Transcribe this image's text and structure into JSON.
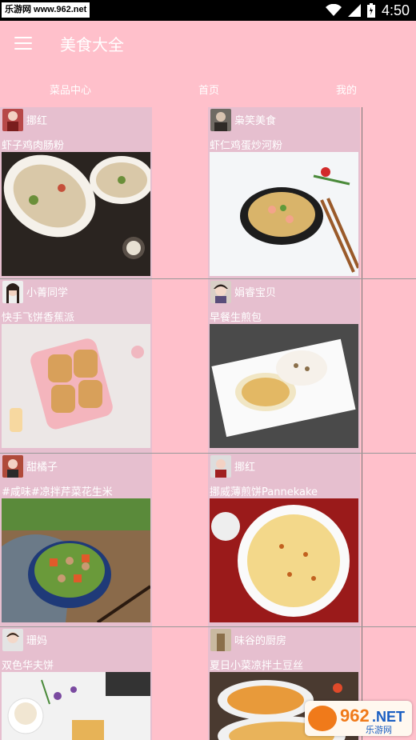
{
  "status_bar": {
    "watermark": "乐游网 www.962.net",
    "time": "4:50"
  },
  "app_bar": {
    "title": "美食大全",
    "menu_icon": "hamburger-menu-icon"
  },
  "tabs": [
    {
      "label": "菜品中心"
    },
    {
      "label": "首页"
    },
    {
      "label": "我的"
    }
  ],
  "cards": [
    {
      "author": "挪红",
      "dish": "虾子鸡肉肠粉",
      "photo": "rice-noodle-rolls-in-white-dishes"
    },
    {
      "author": "枭笑美食",
      "dish": "虾仁鸡蛋炒河粉",
      "photo": "fried-noodles-in-black-pan"
    },
    {
      "author": "小菁同学",
      "dish": "快手飞饼香蕉派",
      "photo": "banana-pies-on-pink-plate"
    },
    {
      "author": "娟睿宝贝",
      "dish": "早餐生煎包",
      "photo": "pan-fried-buns-on-white-plate"
    },
    {
      "author": "甜橘子",
      "dish": "#咸味#凉拌芹菜花生米",
      "photo": "celery-peanut-salad-bowl"
    },
    {
      "author": "挪红",
      "dish": "挪威薄煎饼Pannekake",
      "photo": "crepe-on-white-plate"
    },
    {
      "author": "珊妈",
      "dish": "双色华夫饼",
      "photo": "waffles-and-tea"
    },
    {
      "author": "味谷的厨房",
      "dish": "夏日小菜凉拌土豆丝",
      "photo": "shredded-potato-salad"
    }
  ],
  "corner_logo": {
    "brand": "962.NET",
    "subtitle": "乐游网"
  },
  "colors": {
    "background": "#ffc0cb",
    "card": "#e6bfcf",
    "text": "#ffffff"
  }
}
